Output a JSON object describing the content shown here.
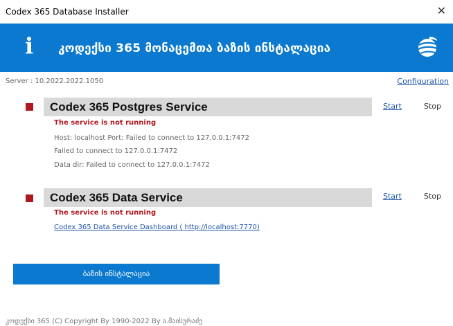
{
  "window": {
    "title": "Codex 365 Database Installer",
    "close_glyph": "✕"
  },
  "banner": {
    "info_glyph": "i",
    "heading": "კოდექსი 365 მონაცემთა ბაზის ინსტალაცია",
    "logo_icon": "globe-logo-icon",
    "background": "#0a79cf"
  },
  "server_label": "Server : 10.2022.2022.1050",
  "configuration_label": "Configuration",
  "services": [
    {
      "name": "Codex 365 Postgres Service",
      "status": "The service is not running",
      "details": [
        "Host: localhost Port: Failed to connect to 127.0.0.1:7472",
        "Failed to connect to 127.0.0.1:7472",
        "Data dir: Failed to connect to 127.0.0.1:7472"
      ],
      "start_label": "Start",
      "stop_label": "Stop"
    },
    {
      "name": "Codex 365 Data Service",
      "status": "The service is not running",
      "dashboard_link": "Codex 365 Data Service Dashboard ( http://localhost:7770)",
      "start_label": "Start",
      "stop_label": "Stop"
    }
  ],
  "install_button": "ბაზის ინსტალაცია",
  "footer": "კოდექსი 365 (C) Copyright By 1990-2022 By ა.მაისურაძე",
  "colors": {
    "accent": "#0a79cf",
    "status_red": "#b01820",
    "link": "#1f55a8"
  }
}
